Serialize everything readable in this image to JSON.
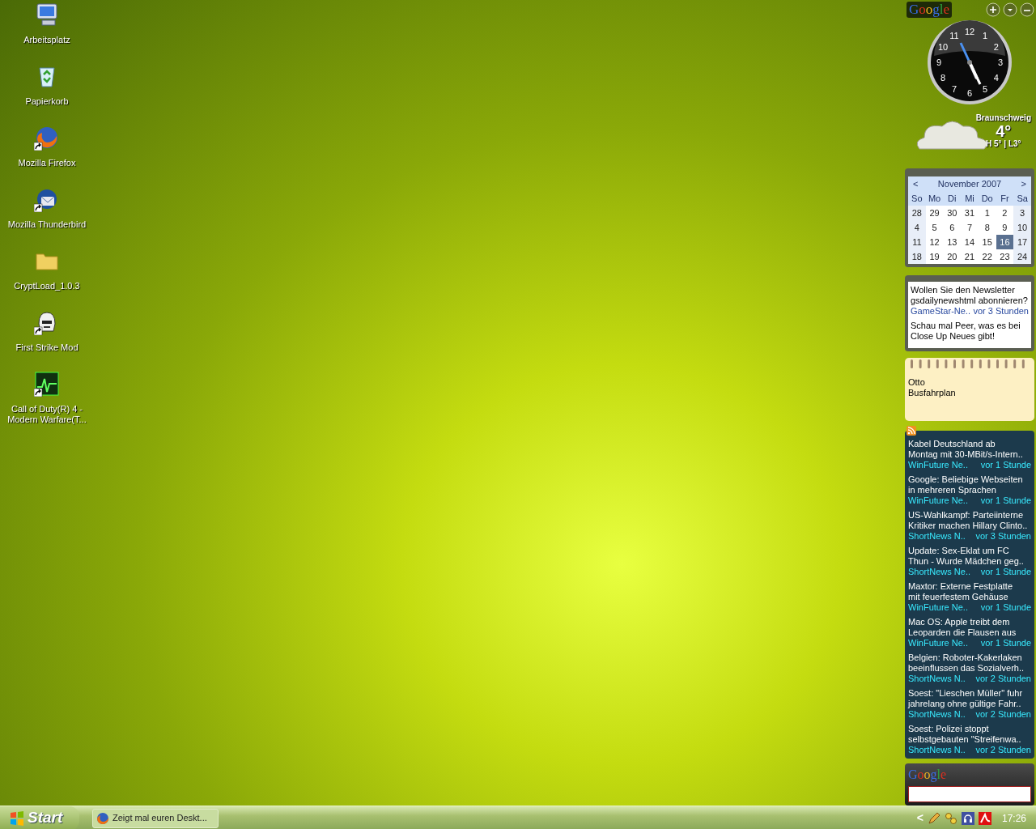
{
  "desktop_icons": [
    {
      "label": "Arbeitsplatz",
      "kind": "computer",
      "shortcut": false
    },
    {
      "label": "Papierkorb",
      "kind": "recycle",
      "shortcut": false
    },
    {
      "label": "Mozilla Firefox",
      "kind": "firefox",
      "shortcut": true
    },
    {
      "label": "Mozilla Thunderbird",
      "kind": "thunderbird",
      "shortcut": true
    },
    {
      "label": "CryptLoad_1.0.3",
      "kind": "folder",
      "shortcut": false
    },
    {
      "label": "First Strike Mod",
      "kind": "helmet",
      "shortcut": true
    },
    {
      "label": "Call of Duty(R) 4 - Modern Warfare(T...",
      "kind": "game",
      "shortcut": true
    }
  ],
  "sidebar": {
    "logo": "Google",
    "clock": {
      "numerals": [
        "12",
        "1",
        "2",
        "3",
        "4",
        "5",
        "6",
        "7",
        "8",
        "9",
        "10",
        "11"
      ]
    },
    "weather": {
      "city": "Braunschweig",
      "temperature": "4°",
      "range": "H 5° | L3°"
    },
    "calendar": {
      "prev": "<",
      "month": "November 2007",
      "next": ">",
      "weekdays": [
        "So",
        "Mo",
        "Di",
        "Mi",
        "Do",
        "Fr",
        "Sa"
      ],
      "weeks": [
        [
          {
            "label": "28",
            "selected": false
          },
          {
            "label": "29",
            "selected": false
          },
          {
            "label": "30",
            "selected": false
          },
          {
            "label": "31",
            "selected": false
          },
          {
            "label": "1",
            "selected": false
          },
          {
            "label": "2",
            "selected": false
          },
          {
            "label": "3",
            "selected": false
          }
        ],
        [
          {
            "label": "4",
            "selected": false
          },
          {
            "label": "5",
            "selected": false
          },
          {
            "label": "6",
            "selected": false
          },
          {
            "label": "7",
            "selected": false
          },
          {
            "label": "8",
            "selected": false
          },
          {
            "label": "9",
            "selected": false
          },
          {
            "label": "10",
            "selected": false
          }
        ],
        [
          {
            "label": "11",
            "selected": false
          },
          {
            "label": "12",
            "selected": false
          },
          {
            "label": "13",
            "selected": false
          },
          {
            "label": "14",
            "selected": false
          },
          {
            "label": "15",
            "selected": false
          },
          {
            "label": "16",
            "selected": true
          },
          {
            "label": "17",
            "selected": false
          }
        ],
        [
          {
            "label": "18",
            "selected": false
          },
          {
            "label": "19",
            "selected": false
          },
          {
            "label": "20",
            "selected": false
          },
          {
            "label": "21",
            "selected": false
          },
          {
            "label": "22",
            "selected": false
          },
          {
            "label": "23",
            "selected": false
          },
          {
            "label": "24",
            "selected": false
          }
        ]
      ]
    },
    "mail": [
      {
        "lines": [
          "Wollen Sie den Newsletter",
          "gsdailynewshtml abonnieren?"
        ],
        "source": "GameStar-Ne..",
        "time": "vor 3 Stunden"
      },
      {
        "lines": [
          "Schau mal Peer, was es bei",
          "Close Up Neues gibt!"
        ]
      }
    ],
    "notes": [
      "Otto",
      "Busfahrplan"
    ],
    "news": [
      {
        "lines": [
          "Kabel Deutschland ab",
          "Montag mit 30-MBit/s-Intern.."
        ],
        "source": "WinFuture Ne..",
        "time": "vor 1 Stunde"
      },
      {
        "lines": [
          "Google: Beliebige Webseiten",
          "in mehreren Sprachen"
        ],
        "source": "WinFuture Ne..",
        "time": "vor 1 Stunde"
      },
      {
        "lines": [
          "US-Wahlkampf: Parteiinterne",
          "Kritiker machen Hillary Clinto.."
        ],
        "source": "ShortNews N..",
        "time": "vor 3 Stunden"
      },
      {
        "lines": [
          "Update: Sex-Eklat um FC",
          "Thun - Wurde Mädchen geg.."
        ],
        "source": "ShortNews Ne..",
        "time": "vor 1 Stunde"
      },
      {
        "lines": [
          "Maxtor: Externe Festplatte",
          "mit feuerfestem Gehäuse"
        ],
        "source": "WinFuture Ne..",
        "time": "vor 1 Stunde"
      },
      {
        "lines": [
          "Mac OS: Apple treibt dem",
          "Leoparden die Flausen aus"
        ],
        "source": "WinFuture Ne..",
        "time": "vor 1 Stunde"
      },
      {
        "lines": [
          "Belgien: Roboter-Kakerlaken",
          "beeinflussen das Sozialverh.."
        ],
        "source": "ShortNews N..",
        "time": "vor 2 Stunden"
      },
      {
        "lines": [
          "Soest: \"Lieschen Müller\" fuhr",
          "jahrelang ohne gültige Fahr.."
        ],
        "source": "ShortNews N..",
        "time": "vor 2 Stunden"
      },
      {
        "lines": [
          "Soest: Polizei stoppt",
          "selbstgebauten \"Streifenwa.."
        ],
        "source": "ShortNews N..",
        "time": "vor 2 Stunden"
      }
    ],
    "search": {
      "logo": "Google"
    }
  },
  "taskbar": {
    "start": "Start",
    "tasks": [
      {
        "label": "Zeigt mal euren Deskt..."
      }
    ],
    "tray_expand": "<",
    "time": "17:26"
  }
}
